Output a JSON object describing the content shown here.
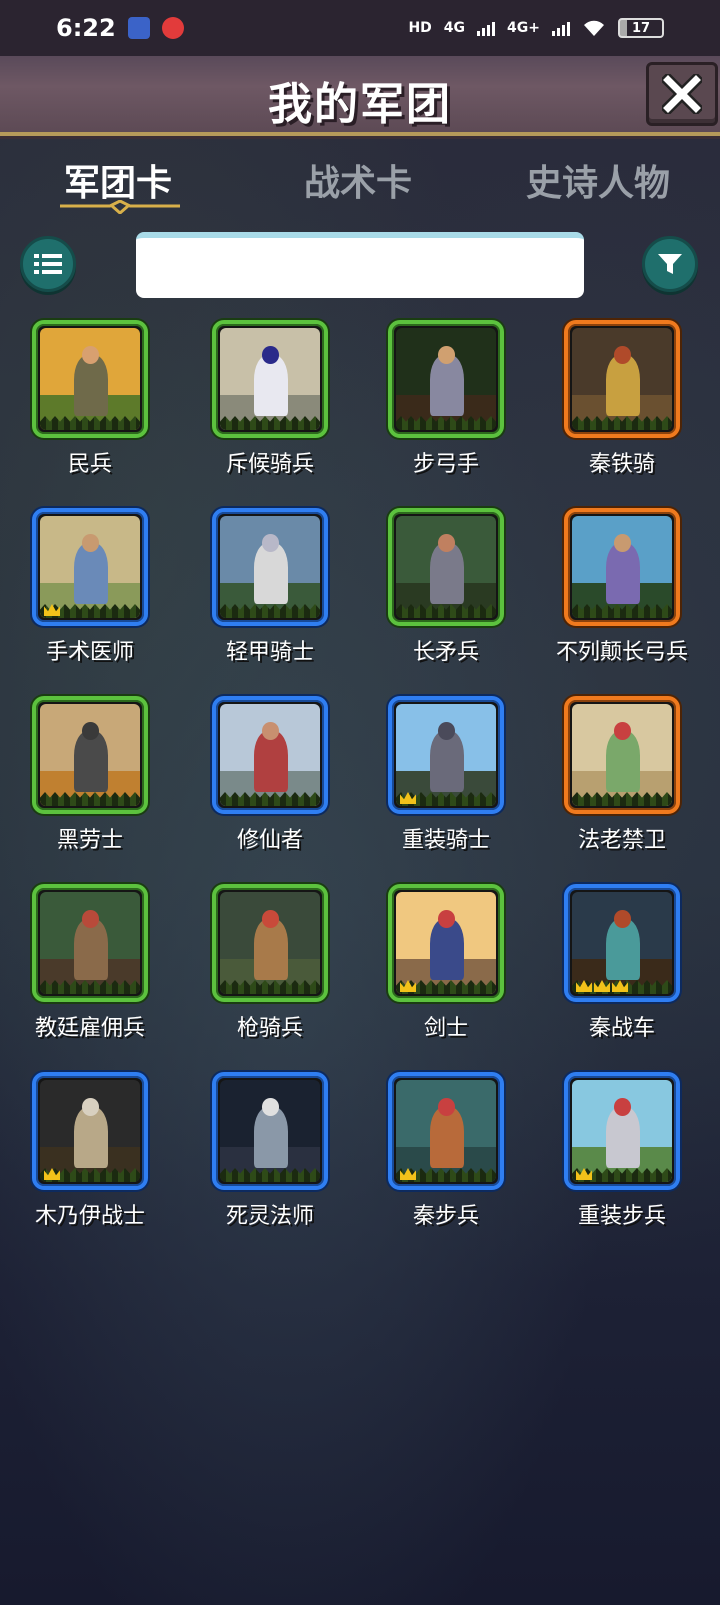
{
  "status_bar": {
    "time": "6:22",
    "network_hd": "HD",
    "network_4g_1": "4G",
    "network_4g_2": "4G+",
    "battery": "17"
  },
  "header": {
    "title": "我的军团"
  },
  "tabs": [
    {
      "label": "军团卡",
      "active": true
    },
    {
      "label": "战术卡",
      "active": false
    },
    {
      "label": "史诗人物",
      "active": false
    }
  ],
  "search": {
    "value": "",
    "placeholder": ""
  },
  "units": [
    {
      "name": "民兵",
      "rarity": "green",
      "crowns": 0,
      "sky": "#e0a63a",
      "ground": "#5d7a2a",
      "body": "#6f6a4a",
      "head": "#d8a070"
    },
    {
      "name": "斥候骑兵",
      "rarity": "green",
      "crowns": 0,
      "sky": "#c8c0a8",
      "ground": "#8a8a7a",
      "body": "#e8e8f0",
      "head": "#2a2a8a"
    },
    {
      "name": "步弓手",
      "rarity": "green",
      "crowns": 0,
      "sky": "#20301a",
      "ground": "#3a2a1a",
      "body": "#8888a0",
      "head": "#d0a070"
    },
    {
      "name": "秦铁骑",
      "rarity": "orange",
      "crowns": 0,
      "sky": "#4a3a2a",
      "ground": "#6a5030",
      "body": "#c8a040",
      "head": "#b04a2a"
    },
    {
      "name": "手术医师",
      "rarity": "blue",
      "crowns": 1,
      "sky": "#c8b888",
      "ground": "#8a9a5a",
      "body": "#6a8ab8",
      "head": "#c89a70"
    },
    {
      "name": "轻甲骑士",
      "rarity": "blue",
      "crowns": 0,
      "sky": "#6a8aa8",
      "ground": "#3a5a3a",
      "body": "#d8d8d8",
      "head": "#b8b8c8"
    },
    {
      "name": "长矛兵",
      "rarity": "green",
      "crowns": 0,
      "sky": "#3a5a3a",
      "ground": "#2a3a22",
      "body": "#7a7a8a",
      "head": "#c08060"
    },
    {
      "name": "不列颠长弓兵",
      "rarity": "orange",
      "crowns": 0,
      "sky": "#5aa0c8",
      "ground": "#2a4a2a",
      "body": "#7a6ab0",
      "head": "#c89a70"
    },
    {
      "name": "黑劳士",
      "rarity": "green",
      "crowns": 0,
      "sky": "#c8a878",
      "ground": "#c08030",
      "body": "#4a4a4a",
      "head": "#3a3a3a"
    },
    {
      "name": "修仙者",
      "rarity": "blue",
      "crowns": 0,
      "sky": "#b8c8d8",
      "ground": "#7a8a8a",
      "body": "#b04040",
      "head": "#c89070"
    },
    {
      "name": "重装骑士",
      "rarity": "blue",
      "crowns": 1,
      "sky": "#88c0e8",
      "ground": "#3a4a3a",
      "body": "#6a6a7a",
      "head": "#4a4a5a"
    },
    {
      "name": "法老禁卫",
      "rarity": "orange",
      "crowns": 0,
      "sky": "#d8c8a0",
      "ground": "#b8a070",
      "body": "#7aa86a",
      "head": "#c84040"
    },
    {
      "name": "教廷雇佣兵",
      "rarity": "green",
      "crowns": 0,
      "sky": "#3a5a3a",
      "ground": "#4a3a2a",
      "body": "#8a6a4a",
      "head": "#b84a3a"
    },
    {
      "name": "枪骑兵",
      "rarity": "green",
      "crowns": 0,
      "sky": "#3a4a3a",
      "ground": "#4a5a3a",
      "body": "#a87a4a",
      "head": "#c84a3a"
    },
    {
      "name": "剑士",
      "rarity": "green",
      "crowns": 1,
      "sky": "#f0c880",
      "ground": "#8a6a4a",
      "body": "#3a4a8a",
      "head": "#c84040"
    },
    {
      "name": "秦战车",
      "rarity": "blue",
      "crowns": 3,
      "sky": "#2a3a4a",
      "ground": "#3a2a1a",
      "body": "#4a9a9a",
      "head": "#b04a2a"
    },
    {
      "name": "木乃伊战士",
      "rarity": "blue",
      "crowns": 1,
      "sky": "#2a2a2a",
      "ground": "#3a3020",
      "body": "#b8a888",
      "head": "#d8d0c0"
    },
    {
      "name": "死灵法师",
      "rarity": "blue",
      "crowns": 0,
      "sky": "#1a2230",
      "ground": "#2a3040",
      "body": "#8a98a8",
      "head": "#e0e0e0"
    },
    {
      "name": "秦步兵",
      "rarity": "blue",
      "crowns": 1,
      "sky": "#3a6a6a",
      "ground": "#2a4a4a",
      "body": "#b86a3a",
      "head": "#c84040"
    },
    {
      "name": "重装步兵",
      "rarity": "blue",
      "crowns": 1,
      "sky": "#88c8e0",
      "ground": "#5a8a4a",
      "body": "#c8c8d0",
      "head": "#c84040"
    }
  ]
}
